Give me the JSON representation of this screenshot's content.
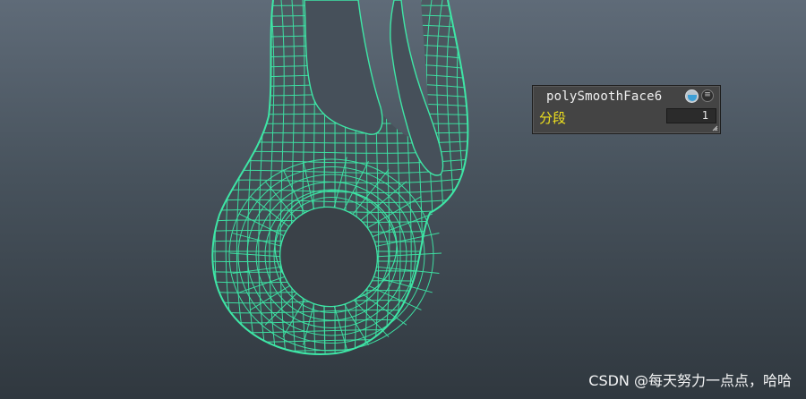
{
  "viewport": {
    "wire_color": "#3ee6a6",
    "background_top": "#5f6b78",
    "background_bottom": "#30383f"
  },
  "hud": {
    "node_name": "polySmoothFace6",
    "attribute_label": "分段",
    "attribute_value": "1",
    "eye_icon": "eye-icon",
    "menu_icon": "list-menu-icon",
    "grip_icon": "resize-grip-icon"
  },
  "watermark": {
    "text": "CSDN @每天努力一点点，哈哈"
  }
}
